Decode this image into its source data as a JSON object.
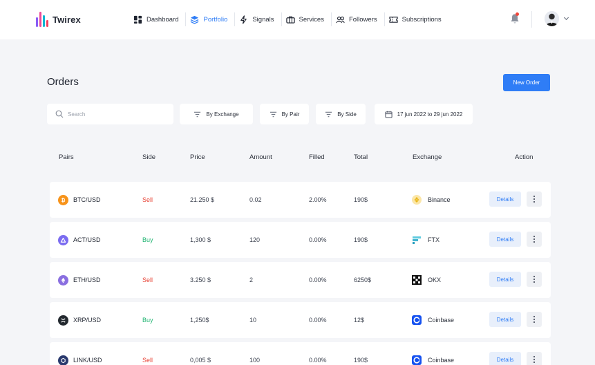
{
  "brand": {
    "name": "Twirex"
  },
  "nav": [
    {
      "label": "Dashboard",
      "icon": "dashboard-icon",
      "active": false
    },
    {
      "label": "Portfolio",
      "icon": "layers-icon",
      "active": true
    },
    {
      "label": "Signals",
      "icon": "signal-icon",
      "active": false
    },
    {
      "label": "Services",
      "icon": "briefcase-icon",
      "active": false
    },
    {
      "label": "Followers",
      "icon": "users-icon",
      "active": false
    },
    {
      "label": "Subscriptions",
      "icon": "ticket-icon",
      "active": false
    }
  ],
  "page": {
    "title": "Orders",
    "new_order_label": "New Order"
  },
  "filters": {
    "search_placeholder": "Search",
    "by_exchange": "By Exchange",
    "by_pair": "By Pair",
    "by_side": "By Side",
    "date_range": "17 jun 2022 to 29 jun 2022"
  },
  "table": {
    "columns": [
      "Pairs",
      "Side",
      "Price",
      "Amount",
      "Filled",
      "Total",
      "Exchange",
      "Action"
    ],
    "rows": [
      {
        "pair": "BTC/USD",
        "coin_icon": "bitcoin-icon",
        "side": "Sell",
        "price": "21.250 $",
        "amount": "0.02",
        "filled": "2.00%",
        "total": "190$",
        "exchange": "Binance",
        "exchange_icon": "binance-icon",
        "action": "Details"
      },
      {
        "pair": "ACT/USD",
        "coin_icon": "act-icon",
        "side": "Buy",
        "price": "1,300 $",
        "amount": "120",
        "filled": "0.00%",
        "total": "190$",
        "exchange": "FTX",
        "exchange_icon": "ftx-icon",
        "action": "Details"
      },
      {
        "pair": "ETH/USD",
        "coin_icon": "ethereum-icon",
        "side": "Sell",
        "price": "3.250 $",
        "amount": "2",
        "filled": "0.00%",
        "total": "6250$",
        "exchange": "OKX",
        "exchange_icon": "okx-icon",
        "action": "Details"
      },
      {
        "pair": "XRP/USD",
        "coin_icon": "xrp-icon",
        "side": "Buy",
        "price": "1,250$",
        "amount": "10",
        "filled": "0.00%",
        "total": "12$",
        "exchange": "Coinbase",
        "exchange_icon": "coinbase-icon",
        "action": "Details"
      },
      {
        "pair": "LINK/USD",
        "coin_icon": "chainlink-icon",
        "side": "Sell",
        "price": "0,005 $",
        "amount": "100",
        "filled": "0.00%",
        "total": "190$",
        "exchange": "Coinbase",
        "exchange_icon": "coinbase-icon",
        "action": "Details"
      }
    ]
  },
  "colors": {
    "accent": "#2f7df6",
    "sell": "#e8463a",
    "buy": "#22b573",
    "background": "#f4f5f8"
  }
}
